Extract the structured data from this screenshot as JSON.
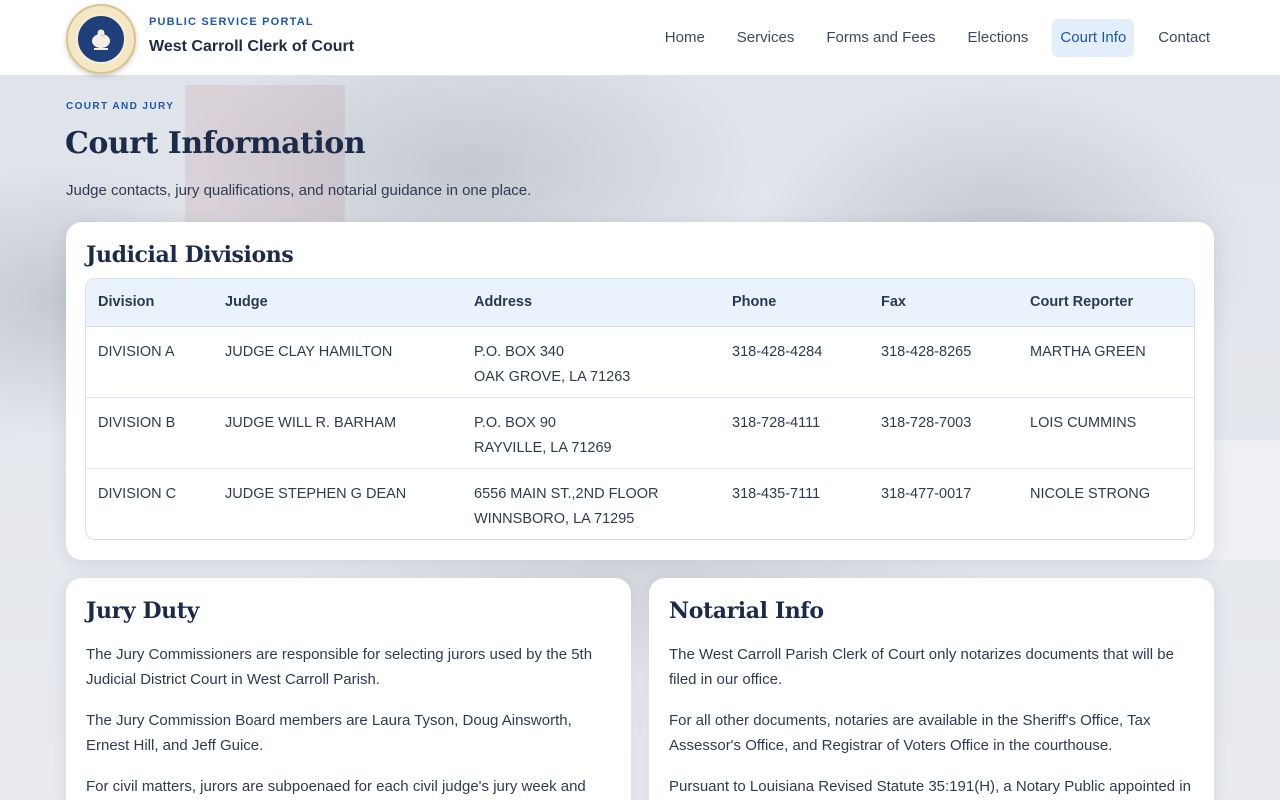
{
  "header": {
    "kicker": "PUBLIC SERVICE PORTAL",
    "title": "West Carroll Clerk of Court",
    "nav": [
      {
        "label": "Home"
      },
      {
        "label": "Services"
      },
      {
        "label": "Forms and Fees"
      },
      {
        "label": "Elections"
      },
      {
        "label": "Court Info",
        "active": true
      },
      {
        "label": "Contact"
      }
    ]
  },
  "page": {
    "kicker": "COURT AND JURY",
    "title": "Court Information",
    "subtitle": "Judge contacts, jury qualifications, and notarial guidance in one place."
  },
  "divisions": {
    "title": "Judicial Divisions",
    "columns": [
      "Division",
      "Judge",
      "Address",
      "Phone",
      "Fax",
      "Court Reporter"
    ],
    "rows": [
      {
        "division": "DIVISION A",
        "judge": "JUDGE CLAY HAMILTON",
        "address1": "P.O. BOX 340",
        "address2": "OAK GROVE, LA 71263",
        "phone": "318-428-4284",
        "fax": "318-428-8265",
        "reporter": "MARTHA GREEN"
      },
      {
        "division": "DIVISION B",
        "judge": "JUDGE WILL R. BARHAM",
        "address1": "P.O. BOX 90",
        "address2": "RAYVILLE, LA 71269",
        "phone": "318-728-4111",
        "fax": "318-728-7003",
        "reporter": "LOIS CUMMINS"
      },
      {
        "division": "DIVISION C",
        "judge": "JUDGE STEPHEN G DEAN",
        "address1": "6556 MAIN ST.,2ND FLOOR",
        "address2": "WINNSBORO, LA 71295",
        "phone": "318-435-7111",
        "fax": "318-477-0017",
        "reporter": "NICOLE STRONG"
      }
    ]
  },
  "jury": {
    "title": "Jury Duty",
    "paragraphs": [
      "The Jury Commissioners are responsible for selecting jurors used by the 5th Judicial District Court in West Carroll Parish.",
      "The Jury Commission Board members are Laura Tyson, Doug Ainsworth, Ernest Hill, and Jeff Guice.",
      "For civil matters, jurors are subpoenaed for each civil judge's jury week and"
    ]
  },
  "notary": {
    "title": "Notarial Info",
    "paragraphs": [
      "The West Carroll Parish Clerk of Court only notarizes documents that will be filed in our office.",
      "For all other documents, notaries are available in the Sheriff's Office, Tax Assessor's Office, and Registrar of Voters Office in the courthouse.",
      "Pursuant to Louisiana Revised Statute 35:191(H), a Notary Public appointed in"
    ]
  }
}
